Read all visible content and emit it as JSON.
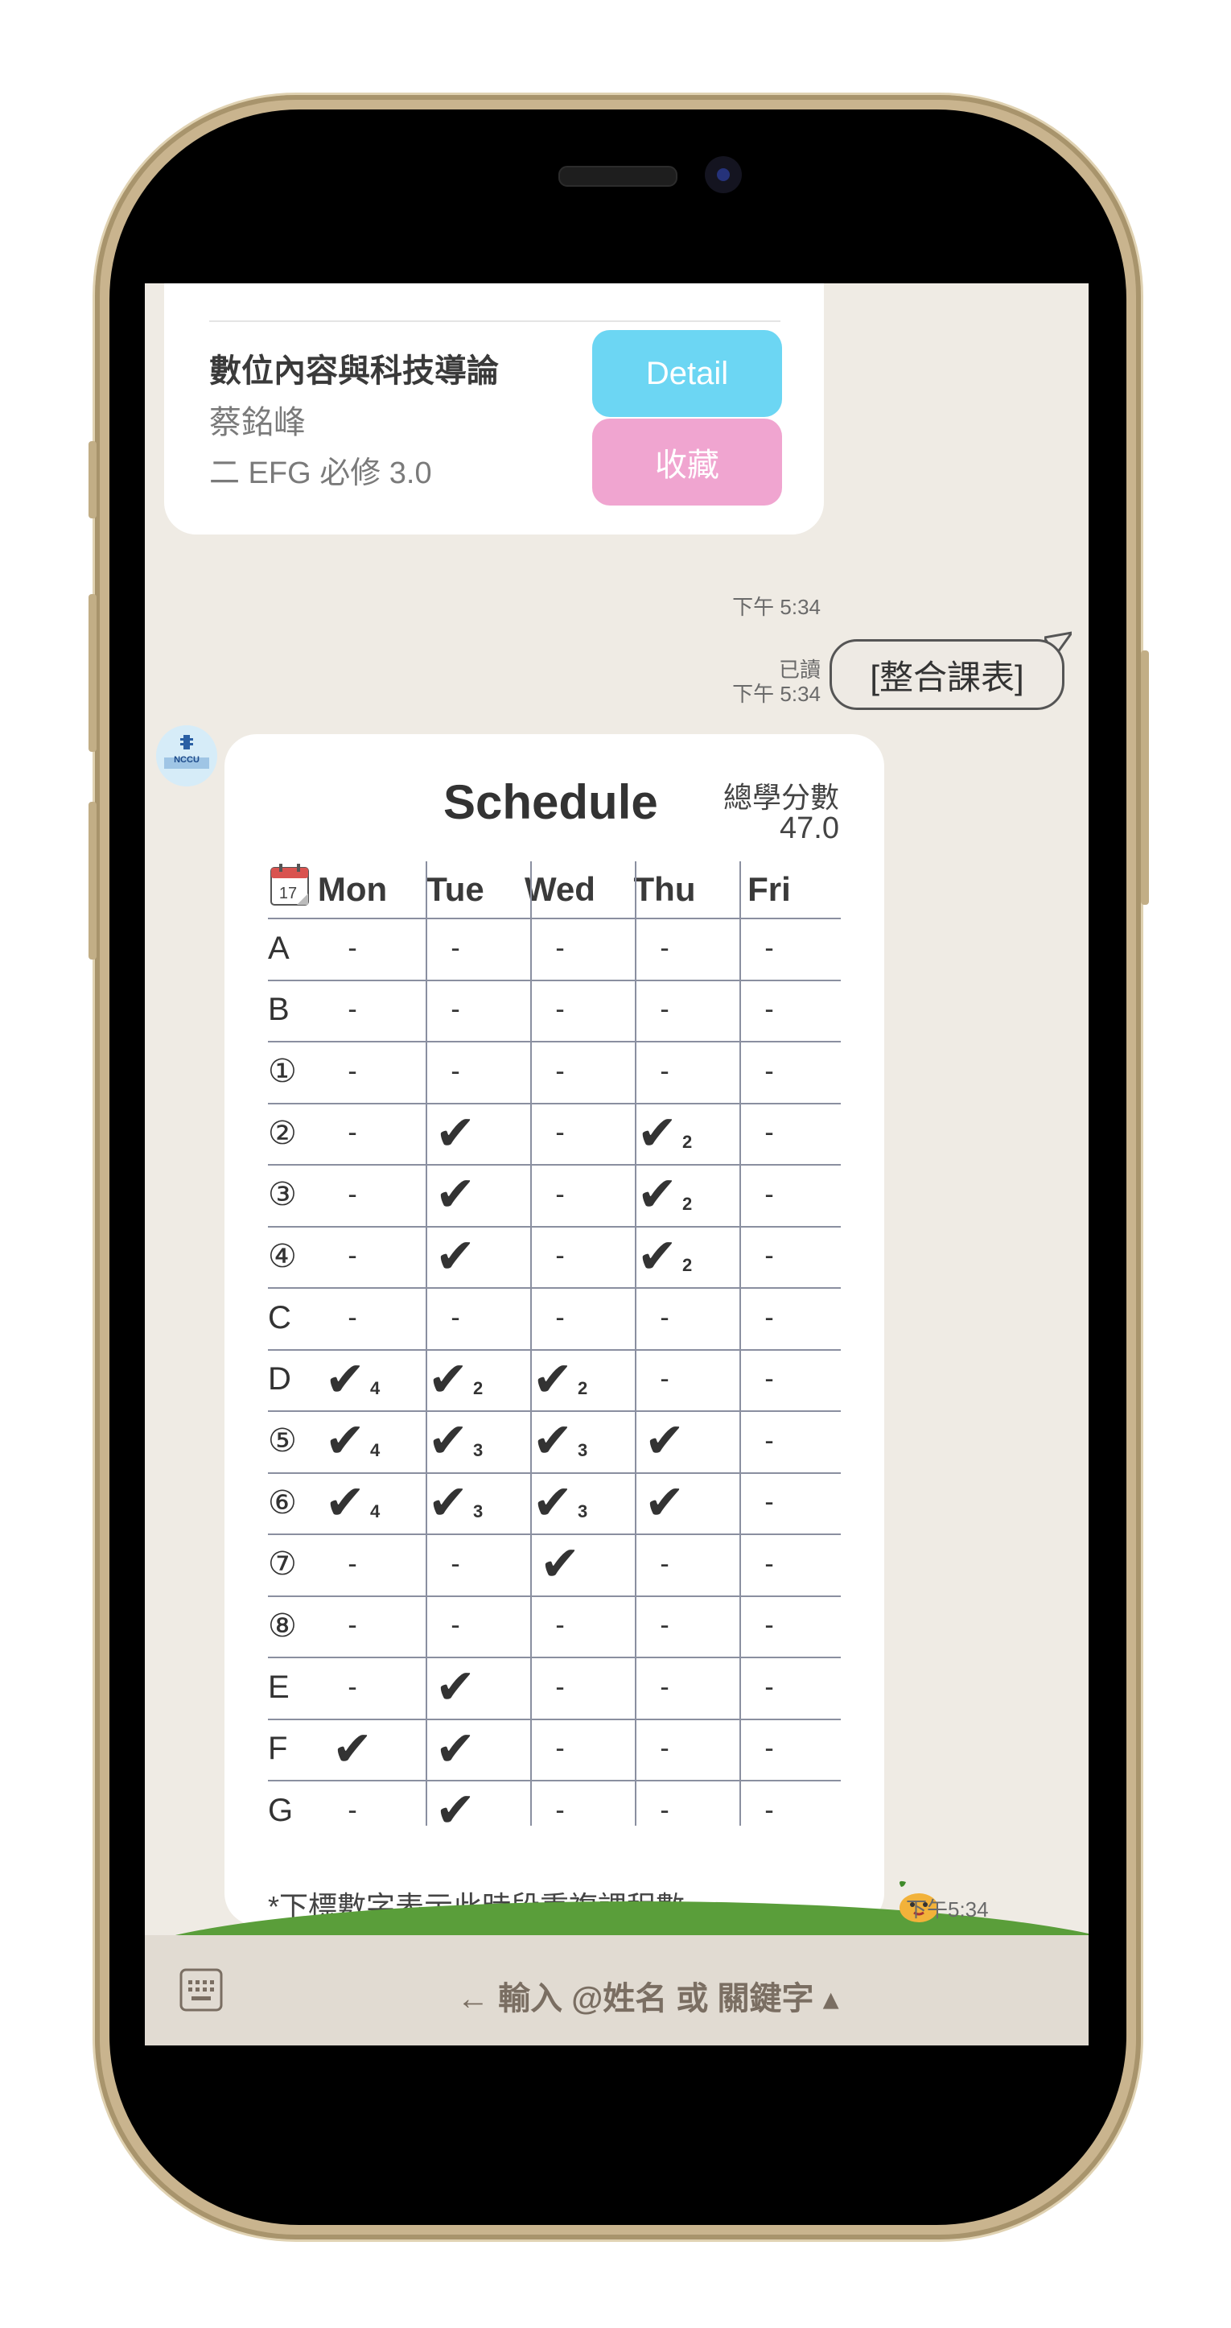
{
  "course": {
    "title": "數位內容與科技導論",
    "teacher": "蔡銘峰",
    "info": "二 EFG 必修 3.0",
    "detail_label": "Detail",
    "favorite_label": "收藏"
  },
  "messages": {
    "time1": "下午 5:34",
    "read_label": "已讀",
    "time2": "下午 5:34",
    "user_bubble": "[整合課表]",
    "time3": "下午5:34"
  },
  "avatar": {
    "text": "NCCU"
  },
  "schedule": {
    "title": "Schedule",
    "credits_label": "總學分數",
    "credits_value": "47.0",
    "calendar_day": "17",
    "days": [
      "Mon",
      "Tue",
      "Wed",
      "Thu",
      "Fri"
    ],
    "rows": [
      {
        "label": "A",
        "cells": [
          "-",
          "-",
          "-",
          "-",
          "-"
        ]
      },
      {
        "label": "B",
        "cells": [
          "-",
          "-",
          "-",
          "-",
          "-"
        ]
      },
      {
        "label": "①",
        "cells": [
          "-",
          "-",
          "-",
          "-",
          "-"
        ]
      },
      {
        "label": "②",
        "cells": [
          "-",
          "✔",
          "-",
          "✔2",
          "-"
        ]
      },
      {
        "label": "③",
        "cells": [
          "-",
          "✔",
          "-",
          "✔2",
          "-"
        ]
      },
      {
        "label": "④",
        "cells": [
          "-",
          "✔",
          "-",
          "✔2",
          "-"
        ]
      },
      {
        "label": "C",
        "cells": [
          "-",
          "-",
          "-",
          "-",
          "-"
        ]
      },
      {
        "label": "D",
        "cells": [
          "✔4",
          "✔2",
          "✔2",
          "-",
          "-"
        ]
      },
      {
        "label": "⑤",
        "cells": [
          "✔4",
          "✔3",
          "✔3",
          "✔",
          "-"
        ]
      },
      {
        "label": "⑥",
        "cells": [
          "✔4",
          "✔3",
          "✔3",
          "✔",
          "-"
        ]
      },
      {
        "label": "⑦",
        "cells": [
          "-",
          "-",
          "✔",
          "-",
          "-"
        ]
      },
      {
        "label": "⑧",
        "cells": [
          "-",
          "-",
          "-",
          "-",
          "-"
        ]
      },
      {
        "label": "E",
        "cells": [
          "-",
          "✔",
          "-",
          "-",
          "-"
        ]
      },
      {
        "label": "F",
        "cells": [
          "✔",
          "✔",
          "-",
          "-",
          "-"
        ]
      },
      {
        "label": "G",
        "cells": [
          "-",
          "✔",
          "-",
          "-",
          "-"
        ]
      }
    ],
    "note": "*下標數字表示此時段重複課程數"
  },
  "input": {
    "placeholder": "← 輸入 @姓名 或 關鍵字 ▴"
  },
  "colors": {
    "detail": "#6cd6f3",
    "favorite": "#f0a5d0",
    "chat_bg": "#efebe4",
    "hill": "#5a9e3a"
  },
  "icons": [
    "calendar-icon",
    "keyboard-icon",
    "sticker-icon",
    "avatar-logo"
  ]
}
